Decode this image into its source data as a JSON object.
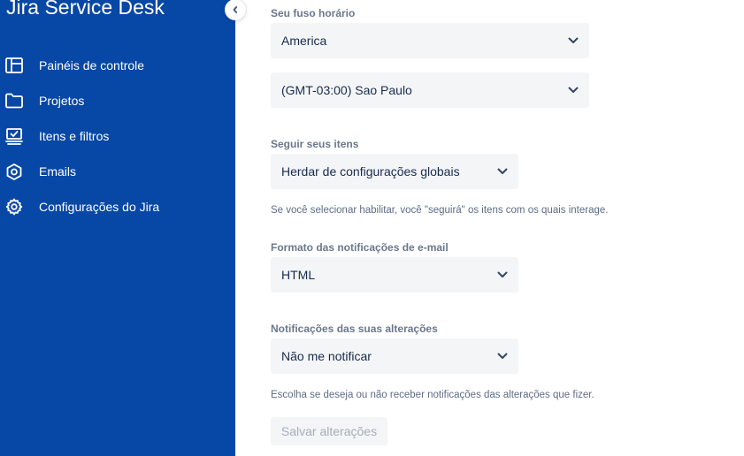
{
  "sidebar": {
    "title": "Jira Service Desk",
    "items": [
      {
        "label": "Painéis de controle",
        "icon": "dashboard-icon"
      },
      {
        "label": "Projetos",
        "icon": "folder-icon"
      },
      {
        "label": "Itens e filtros",
        "icon": "issues-icon"
      },
      {
        "label": "Emails",
        "icon": "email-icon"
      },
      {
        "label": "Configurações do Jira",
        "icon": "gear-icon"
      }
    ],
    "colors": {
      "background": "#0747a6",
      "text": "#ffffff"
    }
  },
  "form": {
    "timezone": {
      "label": "Seu fuso horário",
      "region_value": "America",
      "zone_value": "(GMT-03:00) Sao Paulo"
    },
    "watch": {
      "label": "Seguir seus itens",
      "value": "Herdar de configurações globais",
      "helper": "Se você selecionar habilitar, você \"seguirá\" os itens com os quais interage."
    },
    "email_format": {
      "label": "Formato das notificações de e-mail",
      "value": "HTML"
    },
    "own_changes": {
      "label": "Notificações das suas alterações",
      "value": "Não me notificar",
      "helper": "Escolha se deseja ou não receber notificações das alterações que fizer."
    },
    "save_label": "Salvar alterações"
  }
}
